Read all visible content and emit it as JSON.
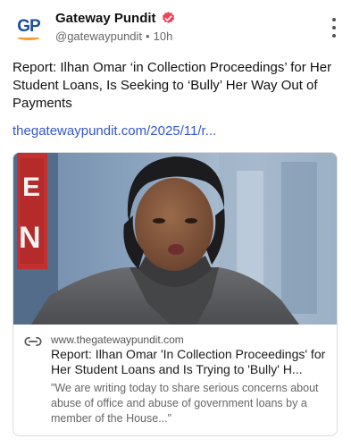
{
  "account": {
    "avatar_text": "GP",
    "display_name": "Gateway Pundit",
    "handle": "@gatewaypundit",
    "separator": "•",
    "timestamp": "10h",
    "verified": true
  },
  "post": {
    "text": "Report: Ilhan Omar ‘in Collection Proceedings’ for Her Student Loans, Is Seeking to ‘Bully’ Her Way Out of Payments",
    "link": "thegatewaypundit.com/2025/11/r..."
  },
  "link_card": {
    "domain": "www.thegatewaypundit.com",
    "title": "Report: Ilhan Omar 'In Collection Proceedings' for Her Student Loans and Is Trying to 'Bully' H...",
    "description": "\"We are writing today to share serious concerns about abuse of office and abuse of government loans by a member of the House...\""
  },
  "colors": {
    "link": "#3457c9",
    "brand_blue": "#1f4e9a",
    "brand_orange": "#f0a02a",
    "verified": "#e8475b"
  },
  "icons": [
    "more-options-icon",
    "verified-badge-icon",
    "link-chain-icon"
  ]
}
